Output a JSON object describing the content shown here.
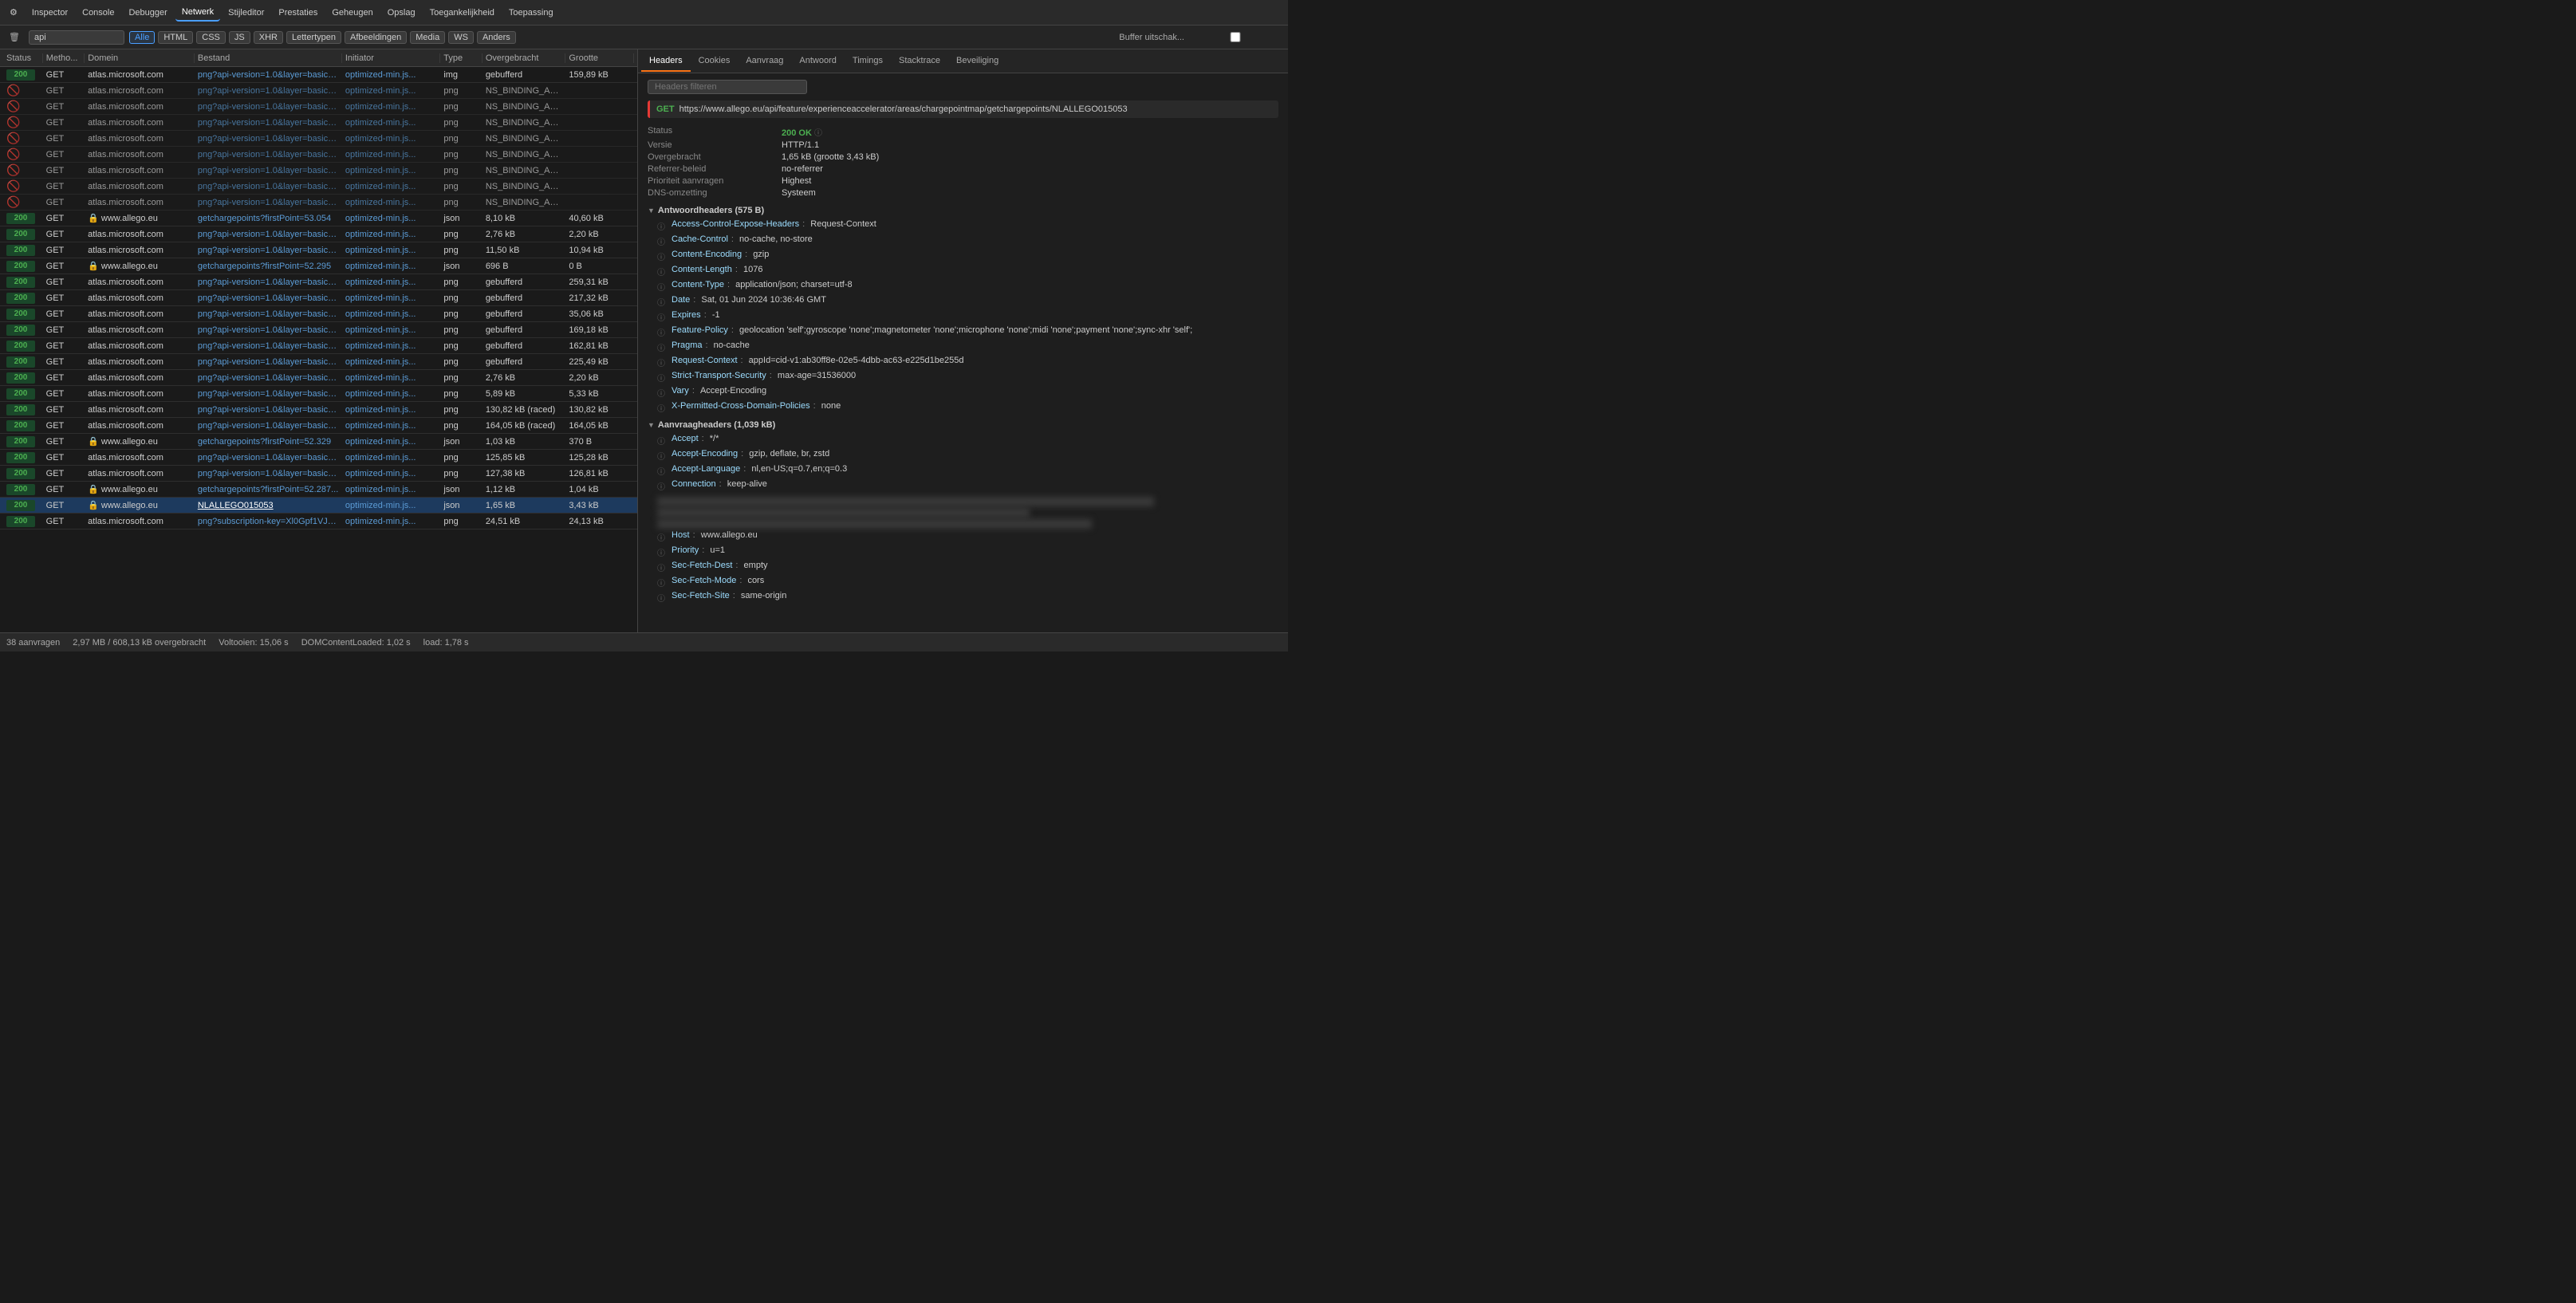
{
  "toolbar": {
    "items": [
      {
        "label": "Inspector",
        "icon": "🔍",
        "active": false
      },
      {
        "label": "Console",
        "icon": "⬛",
        "active": false
      },
      {
        "label": "Debugger",
        "icon": "⬛",
        "active": false
      },
      {
        "label": "Netwerk",
        "icon": "⬆",
        "active": true
      },
      {
        "label": "Stijleditor",
        "icon": "{}",
        "active": false
      },
      {
        "label": "Prestaties",
        "icon": "〰",
        "active": false
      },
      {
        "label": "Geheugen",
        "icon": "⬛",
        "active": false
      },
      {
        "label": "Opslag",
        "icon": "⬛",
        "active": false
      },
      {
        "label": "Toegankelijkheid",
        "icon": "♿",
        "active": false
      },
      {
        "label": "Toepassing",
        "icon": "⬛",
        "active": false
      }
    ]
  },
  "filter_toolbar": {
    "search_placeholder": "api",
    "search_value": "api",
    "filter_tags": [
      "Alle",
      "HTML",
      "CSS",
      "JS",
      "XHR",
      "Lettertypen",
      "Afbeeldingen",
      "Media",
      "WS",
      "Anders"
    ],
    "active_tag": "Alle",
    "buffer_label": "Buffer uitschak..."
  },
  "columns": {
    "status": "Status",
    "method": "Metho...",
    "domain": "Domein",
    "file": "Bestand",
    "initiator": "Initiator",
    "type": "Type",
    "transferred": "Overgebracht",
    "size": "Grootte"
  },
  "rows": [
    {
      "status": "200",
      "method": "GET",
      "domain": "atlas.microsoft.com",
      "file": "png?api-version=1.0&layer=basic&...",
      "initiator": "optimized-min.js...",
      "type": "img",
      "transferred": "gebufferd",
      "size": "159,89 kB",
      "blocked": false,
      "selected": false
    },
    {
      "status": "blocked",
      "method": "GET",
      "domain": "atlas.microsoft.com",
      "file": "png?api-version=1.0&layer=basic&...",
      "initiator": "optimized-min.js...",
      "type": "png",
      "transferred": "NS_BINDING_AB...",
      "size": "",
      "blocked": true,
      "selected": false
    },
    {
      "status": "blocked",
      "method": "GET",
      "domain": "atlas.microsoft.com",
      "file": "png?api-version=1.0&layer=basic&...",
      "initiator": "optimized-min.js...",
      "type": "png",
      "transferred": "NS_BINDING_AB...",
      "size": "",
      "blocked": true,
      "selected": false
    },
    {
      "status": "blocked",
      "method": "GET",
      "domain": "atlas.microsoft.com",
      "file": "png?api-version=1.0&layer=basic&...",
      "initiator": "optimized-min.js...",
      "type": "png",
      "transferred": "NS_BINDING_AB...",
      "size": "",
      "blocked": true,
      "selected": false
    },
    {
      "status": "blocked",
      "method": "GET",
      "domain": "atlas.microsoft.com",
      "file": "png?api-version=1.0&layer=basic&...",
      "initiator": "optimized-min.js...",
      "type": "png",
      "transferred": "NS_BINDING_AB...",
      "size": "",
      "blocked": true,
      "selected": false
    },
    {
      "status": "blocked",
      "method": "GET",
      "domain": "atlas.microsoft.com",
      "file": "png?api-version=1.0&layer=basic&...",
      "initiator": "optimized-min.js...",
      "type": "png",
      "transferred": "NS_BINDING_AB...",
      "size": "",
      "blocked": true,
      "selected": false
    },
    {
      "status": "blocked",
      "method": "GET",
      "domain": "atlas.microsoft.com",
      "file": "png?api-version=1.0&layer=basic&...",
      "initiator": "optimized-min.js...",
      "type": "png",
      "transferred": "NS_BINDING_AB...",
      "size": "",
      "blocked": true,
      "selected": false
    },
    {
      "status": "blocked",
      "method": "GET",
      "domain": "atlas.microsoft.com",
      "file": "png?api-version=1.0&layer=basic&...",
      "initiator": "optimized-min.js...",
      "type": "png",
      "transferred": "NS_BINDING_AB...",
      "size": "",
      "blocked": true,
      "selected": false
    },
    {
      "status": "blocked",
      "method": "GET",
      "domain": "atlas.microsoft.com",
      "file": "png?api-version=1.0&layer=basic&...",
      "initiator": "optimized-min.js...",
      "type": "png",
      "transferred": "NS_BINDING_AB...",
      "size": "",
      "blocked": true,
      "selected": false
    },
    {
      "status": "200",
      "method": "GET",
      "domain": "🔒 www.allego.eu",
      "file": "getchargepoints?firstPoint=53.054",
      "initiator": "optimized-min.js...",
      "type": "json",
      "transferred": "8,10 kB",
      "size": "40,60 kB",
      "blocked": false,
      "selected": false
    },
    {
      "status": "200",
      "method": "GET",
      "domain": "atlas.microsoft.com",
      "file": "png?api-version=1.0&layer=basic&...",
      "initiator": "optimized-min.js...",
      "type": "png",
      "transferred": "2,76 kB",
      "size": "2,20 kB",
      "blocked": false,
      "selected": false
    },
    {
      "status": "200",
      "method": "GET",
      "domain": "atlas.microsoft.com",
      "file": "png?api-version=1.0&layer=basic&...",
      "initiator": "optimized-min.js...",
      "type": "png",
      "transferred": "11,50 kB",
      "size": "10,94 kB",
      "blocked": false,
      "selected": false
    },
    {
      "status": "200",
      "method": "GET",
      "domain": "🔒 www.allego.eu",
      "file": "getchargepoints?firstPoint=52.295",
      "initiator": "optimized-min.js...",
      "type": "json",
      "transferred": "696 B",
      "size": "0 B",
      "blocked": false,
      "selected": false
    },
    {
      "status": "200",
      "method": "GET",
      "domain": "atlas.microsoft.com",
      "file": "png?api-version=1.0&layer=basic&...",
      "initiator": "optimized-min.js...",
      "type": "png",
      "transferred": "gebufferd",
      "size": "259,31 kB",
      "blocked": false,
      "selected": false
    },
    {
      "status": "200",
      "method": "GET",
      "domain": "atlas.microsoft.com",
      "file": "png?api-version=1.0&layer=basic&...",
      "initiator": "optimized-min.js...",
      "type": "png",
      "transferred": "gebufferd",
      "size": "217,32 kB",
      "blocked": false,
      "selected": false
    },
    {
      "status": "200",
      "method": "GET",
      "domain": "atlas.microsoft.com",
      "file": "png?api-version=1.0&layer=basic&...",
      "initiator": "optimized-min.js...",
      "type": "png",
      "transferred": "gebufferd",
      "size": "35,06 kB",
      "blocked": false,
      "selected": false
    },
    {
      "status": "200",
      "method": "GET",
      "domain": "atlas.microsoft.com",
      "file": "png?api-version=1.0&layer=basic&...",
      "initiator": "optimized-min.js...",
      "type": "png",
      "transferred": "gebufferd",
      "size": "169,18 kB",
      "blocked": false,
      "selected": false
    },
    {
      "status": "200",
      "method": "GET",
      "domain": "atlas.microsoft.com",
      "file": "png?api-version=1.0&layer=basic&...",
      "initiator": "optimized-min.js...",
      "type": "png",
      "transferred": "gebufferd",
      "size": "162,81 kB",
      "blocked": false,
      "selected": false
    },
    {
      "status": "200",
      "method": "GET",
      "domain": "atlas.microsoft.com",
      "file": "png?api-version=1.0&layer=basic&...",
      "initiator": "optimized-min.js...",
      "type": "png",
      "transferred": "gebufferd",
      "size": "225,49 kB",
      "blocked": false,
      "selected": false
    },
    {
      "status": "200",
      "method": "GET",
      "domain": "atlas.microsoft.com",
      "file": "png?api-version=1.0&layer=basic&...",
      "initiator": "optimized-min.js...",
      "type": "png",
      "transferred": "2,76 kB",
      "size": "2,20 kB",
      "blocked": false,
      "selected": false
    },
    {
      "status": "200",
      "method": "GET",
      "domain": "atlas.microsoft.com",
      "file": "png?api-version=1.0&layer=basic&...",
      "initiator": "optimized-min.js...",
      "type": "png",
      "transferred": "5,89 kB",
      "size": "5,33 kB",
      "blocked": false,
      "selected": false
    },
    {
      "status": "200",
      "method": "GET",
      "domain": "atlas.microsoft.com",
      "file": "png?api-version=1.0&layer=basic&...",
      "initiator": "optimized-min.js...",
      "type": "png",
      "transferred": "130,82 kB (raced)",
      "size": "130,82 kB",
      "blocked": false,
      "selected": false
    },
    {
      "status": "200",
      "method": "GET",
      "domain": "atlas.microsoft.com",
      "file": "png?api-version=1.0&layer=basic&...",
      "initiator": "optimized-min.js...",
      "type": "png",
      "transferred": "164,05 kB (raced)",
      "size": "164,05 kB",
      "blocked": false,
      "selected": false
    },
    {
      "status": "200",
      "method": "GET",
      "domain": "🔒 www.allego.eu",
      "file": "getchargepoints?firstPoint=52.329",
      "initiator": "optimized-min.js...",
      "type": "json",
      "transferred": "1,03 kB",
      "size": "370 B",
      "blocked": false,
      "selected": false
    },
    {
      "status": "200",
      "method": "GET",
      "domain": "atlas.microsoft.com",
      "file": "png?api-version=1.0&layer=basic&...",
      "initiator": "optimized-min.js...",
      "type": "png",
      "transferred": "125,85 kB",
      "size": "125,28 kB",
      "blocked": false,
      "selected": false
    },
    {
      "status": "200",
      "method": "GET",
      "domain": "atlas.microsoft.com",
      "file": "png?api-version=1.0&layer=basic&...",
      "initiator": "optimized-min.js...",
      "type": "png",
      "transferred": "127,38 kB",
      "size": "126,81 kB",
      "blocked": false,
      "selected": false
    },
    {
      "status": "200",
      "method": "GET",
      "domain": "🔒 www.allego.eu",
      "file": "getchargepoints?firstPoint=52.287...",
      "initiator": "optimized-min.js...",
      "type": "json",
      "transferred": "1,12 kB",
      "size": "1,04 kB",
      "blocked": false,
      "selected": false
    },
    {
      "status": "200",
      "method": "GET",
      "domain": "🔒 www.allego.eu",
      "file": "NLALLEGO015053",
      "initiator": "optimized-min.js...",
      "type": "json",
      "transferred": "1,65 kB",
      "size": "3,43 kB",
      "blocked": false,
      "selected": true
    },
    {
      "status": "200",
      "method": "GET",
      "domain": "atlas.microsoft.com",
      "file": "png?subscription-key=Xl0Gpf1VJ1c...",
      "initiator": "optimized-min.js...",
      "type": "png",
      "transferred": "24,51 kB",
      "size": "24,13 kB",
      "blocked": false,
      "selected": false
    }
  ],
  "detail": {
    "tabs": [
      "Headers",
      "Cookies",
      "Aanvraag",
      "Antwoord",
      "Timings",
      "Stacktrace",
      "Beveiliging"
    ],
    "active_tab": "Headers",
    "filter_placeholder": "Headers filteren",
    "request_method": "GET",
    "request_url": "https://www.allego.eu/api/feature/experienceaccelerator/areas/chargepointmap/getchargepoints/NLALLEGO015053",
    "summary": {
      "status_label": "Status",
      "status_value": "200 OK",
      "version_label": "Versie",
      "version_value": "HTTP/1.1",
      "transferred_label": "Overgebracht",
      "transferred_value": "1,65 kB (grootte 3,43 kB)",
      "referrer_label": "Referrer-beleid",
      "referrer_value": "no-referrer",
      "priority_label": "Prioriteit aanvragen",
      "priority_value": "Highest",
      "dns_label": "DNS-omzetting",
      "dns_value": "Systeem"
    },
    "response_headers_section": "Antwoordheaders (575 B)",
    "response_headers": [
      {
        "key": "Access-Control-Expose-Headers",
        "value": "Request-Context"
      },
      {
        "key": "Cache-Control",
        "value": "no-cache, no-store"
      },
      {
        "key": "Content-Encoding",
        "value": "gzip"
      },
      {
        "key": "Content-Length",
        "value": "1076"
      },
      {
        "key": "Content-Type",
        "value": "application/json; charset=utf-8"
      },
      {
        "key": "Date",
        "value": "Sat, 01 Jun 2024 10:36:46 GMT"
      },
      {
        "key": "Expires",
        "value": "-1"
      },
      {
        "key": "Feature-Policy",
        "value": "geolocation 'self';gyroscope 'none';magnetometer 'none';microphone 'none';midi 'none';payment 'none';sync-xhr 'self';"
      },
      {
        "key": "Pragma",
        "value": "no-cache"
      },
      {
        "key": "Request-Context",
        "value": "appId=cid-v1:ab30ff8e-02e5-4dbb-ac63-e225d1be255d"
      },
      {
        "key": "Strict-Transport-Security",
        "value": "max-age=31536000"
      },
      {
        "key": "Vary",
        "value": "Accept-Encoding"
      },
      {
        "key": "X-Permitted-Cross-Domain-Policies",
        "value": "none"
      }
    ],
    "request_headers_section": "Aanvraagheaders (1,039 kB)",
    "request_headers": [
      {
        "key": "Accept",
        "value": "*/*"
      },
      {
        "key": "Accept-Encoding",
        "value": "gzip, deflate, br, zstd"
      },
      {
        "key": "Accept-Language",
        "value": "nl,en-US;q=0.7,en;q=0.3"
      },
      {
        "key": "Connection",
        "value": "keep-alive"
      },
      {
        "key": "Host",
        "value": "www.allego.eu"
      },
      {
        "key": "Priority",
        "value": "u=1"
      },
      {
        "key": "Sec-Fetch-Dest",
        "value": "empty"
      },
      {
        "key": "Sec-Fetch-Mode",
        "value": "cors"
      },
      {
        "key": "Sec-Fetch-Site",
        "value": "same-origin"
      }
    ]
  },
  "statusbar": {
    "requests": "38 aanvragen",
    "transferred": "2,97 MB / 608,13 kB overgebracht",
    "finished": "Voltooien: 15,06 s",
    "domcontent": "DOMContentLoaded: 1,02 s",
    "load": "load: 1,78 s"
  }
}
